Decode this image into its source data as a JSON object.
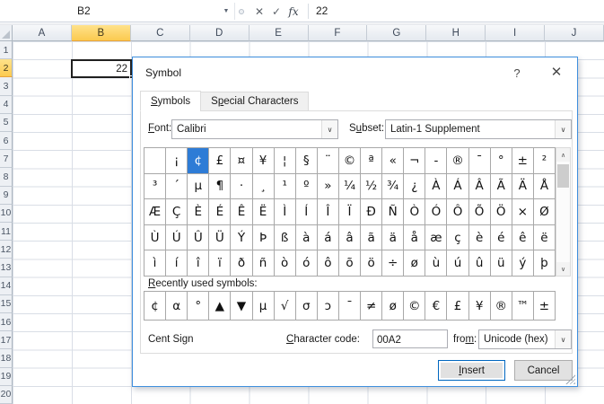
{
  "formula_bar": {
    "name_box": "B2",
    "value": "22",
    "icons": {
      "dropdown": "▼",
      "cancel": "✕",
      "enter": "✓",
      "fx": "fx"
    }
  },
  "sheet": {
    "columns": [
      "A",
      "B",
      "C",
      "D",
      "E",
      "F",
      "G",
      "H",
      "I",
      "J"
    ],
    "rows": [
      "1",
      "2",
      "3",
      "4",
      "5",
      "6",
      "7",
      "8",
      "9",
      "10",
      "11",
      "12",
      "13",
      "14",
      "15",
      "16",
      "17",
      "18",
      "19",
      "20"
    ],
    "selected": {
      "ref": "B2",
      "col": "B",
      "row": "2",
      "value": "22"
    }
  },
  "ui_icons": {
    "chevron": "∨",
    "scroll_up": "∧",
    "scroll_down": "∨"
  },
  "dialog": {
    "title": "Symbol",
    "icons": {
      "help": "?",
      "close": "✕"
    },
    "tabs": [
      {
        "text": "Symbols",
        "u": 0,
        "active": true
      },
      {
        "text": "Special Characters",
        "u": 1,
        "active": false
      }
    ],
    "font": {
      "label": {
        "text": "Font:",
        "u": 0
      },
      "value": "Calibri"
    },
    "subset": {
      "label": {
        "text": "Subset:",
        "u": 1
      },
      "value": "Latin-1 Supplement"
    },
    "symbol_grid": {
      "selected": {
        "row": 0,
        "col": 2
      },
      "rows": [
        [
          "",
          "¡",
          "¢",
          "£",
          "¤",
          "¥",
          "¦",
          "§",
          "¨",
          "©",
          "ª",
          "«",
          "¬",
          "-",
          "®",
          "¯",
          "°",
          "±",
          "²"
        ],
        [
          "³",
          "´",
          "µ",
          "¶",
          "·",
          "¸",
          "¹",
          "º",
          "»",
          "¼",
          "½",
          "¾",
          "¿",
          "À",
          "Á",
          "Â",
          "Ã",
          "Ä",
          "Å"
        ],
        [
          "Æ",
          "Ç",
          "È",
          "É",
          "Ê",
          "Ë",
          "Ì",
          "Í",
          "Î",
          "Ï",
          "Ð",
          "Ñ",
          "Ò",
          "Ó",
          "Ô",
          "Õ",
          "Ö",
          "×",
          "Ø"
        ],
        [
          "Ù",
          "Ú",
          "Û",
          "Ü",
          "Ý",
          "Þ",
          "ß",
          "à",
          "á",
          "â",
          "ã",
          "ä",
          "å",
          "æ",
          "ç",
          "è",
          "é",
          "ê",
          "ë"
        ],
        [
          "ì",
          "í",
          "î",
          "ï",
          "ð",
          "ñ",
          "ò",
          "ó",
          "ô",
          "õ",
          "ö",
          "÷",
          "ø",
          "ù",
          "ú",
          "û",
          "ü",
          "ý",
          "þ"
        ]
      ]
    },
    "recent": {
      "label": {
        "text": "Recently used symbols:",
        "u": 0
      },
      "symbols": [
        "¢",
        "α",
        "°",
        "▲",
        "▼",
        "µ",
        "√",
        "σ",
        "ɔ",
        "¯",
        "≠",
        "ø",
        "©",
        "€",
        "£",
        "¥",
        "®",
        "™",
        "±"
      ]
    },
    "status": {
      "name": "Cent Sign",
      "char_code_label": {
        "text": "Character code:",
        "u": 0
      },
      "char_code": "00A2",
      "from_label": {
        "text": "from:",
        "u": 3
      },
      "from_value": "Unicode (hex)"
    },
    "buttons": {
      "insert": {
        "text": "Insert",
        "u": 0
      },
      "cancel": {
        "text": "Cancel"
      }
    }
  },
  "colors": {
    "dialog_border": "#3F8FDE",
    "selected_symbol_bg": "#2E7CD6",
    "selected_header_bg": "#FBCA4F",
    "gridline": "#D9DEE6",
    "header_bg": "#E4E9EF"
  }
}
